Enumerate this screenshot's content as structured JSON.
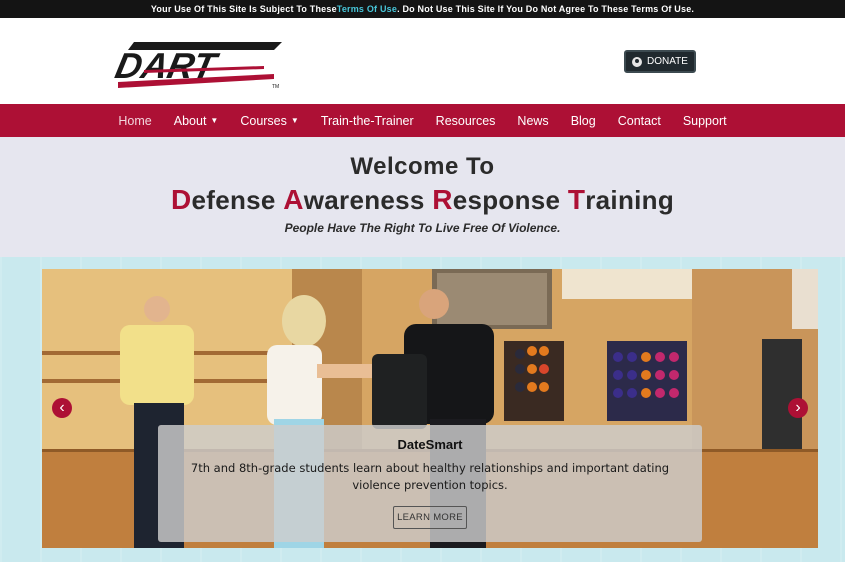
{
  "topbar": {
    "prefix": "Your Use Of This Site Is Subject To These ",
    "link": "Terms Of Use",
    "suffix": ". Do Not Use This Site If You Do Not Agree To These Terms Of Use."
  },
  "header": {
    "logo_text": "DART",
    "logo_tm": "TM",
    "donate_label": "DONATE"
  },
  "nav": {
    "items": [
      {
        "label": "Home",
        "active": true
      },
      {
        "label": "About",
        "dropdown": true
      },
      {
        "label": "Courses",
        "dropdown": true
      },
      {
        "label": "Train-the-Trainer"
      },
      {
        "label": "Resources"
      },
      {
        "label": "News"
      },
      {
        "label": "Blog"
      },
      {
        "label": "Contact"
      },
      {
        "label": "Support"
      }
    ]
  },
  "hero": {
    "welcome": "Welcome To",
    "org": [
      {
        "cap": "D",
        "rest": "efense "
      },
      {
        "cap": "A",
        "rest": "wareness "
      },
      {
        "cap": "R",
        "rest": "esponse "
      },
      {
        "cap": "T",
        "rest": "raining"
      }
    ],
    "tagline": "People Have The Right To Live Free Of Violence."
  },
  "slider": {
    "prev_icon": "chevron-left-icon",
    "next_icon": "chevron-right-icon",
    "slide": {
      "title": "DateSmart",
      "text": "7th and 8th-grade students learn about healthy relationships and important dating violence prevention topics.",
      "button": "LEARN MORE"
    }
  },
  "colors": {
    "brand_red": "#ad1035",
    "topbar_bg": "#141414",
    "terms_link": "#48c6d9",
    "hero_bg": "#e6e6ef",
    "band_bg": "#c9e9ee"
  }
}
